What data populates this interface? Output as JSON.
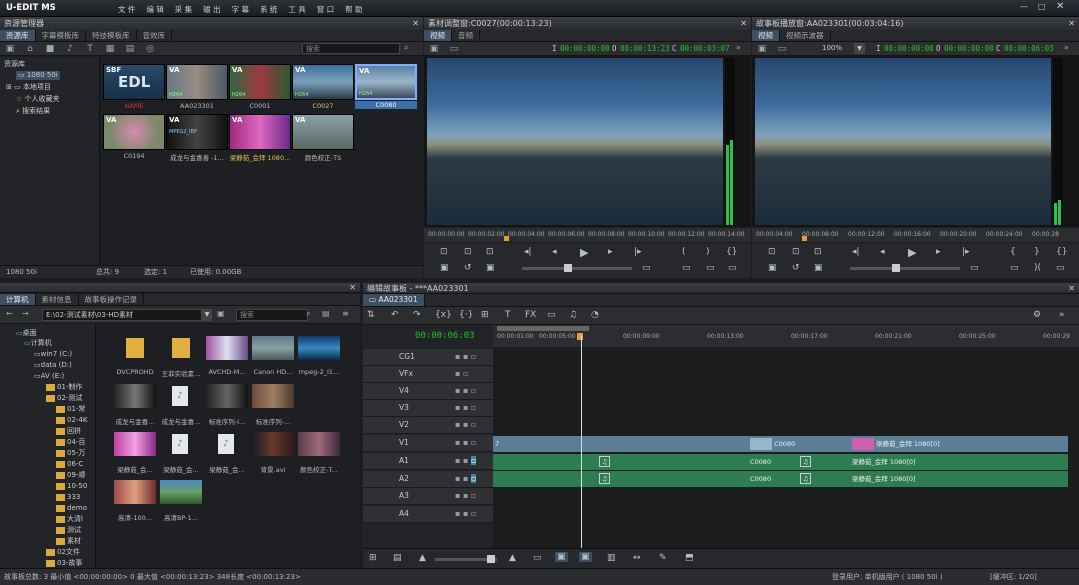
{
  "app": {
    "title": "U-EDIT MS",
    "menu": [
      "文 件",
      "编 辑",
      "采 集",
      "输 出",
      "字 幕",
      "系 统",
      "工 具",
      "窗 口",
      "帮 助"
    ]
  },
  "resource": {
    "title": "资源管理器",
    "tabs": [
      "资源库",
      "字幕模板库",
      "特技模板库",
      "音效库"
    ],
    "search": "搜索",
    "tree_root": "资源库",
    "tree": [
      "1080 50i",
      "本地项目",
      "个人收藏夹",
      "搜索结果"
    ],
    "thumbs": [
      {
        "label": "",
        "badge": "SBF",
        "text": "EDL",
        "color": "#1e3650"
      },
      {
        "label": "AA023301",
        "badge": "VA",
        "color": "#5a6a70"
      },
      {
        "label": "C0001",
        "badge": "VA",
        "color": "#8a3a40"
      },
      {
        "label": "C0027",
        "badge": "VA",
        "color": "#3a6a8a"
      },
      {
        "label": "C0080",
        "badge": "VA",
        "color": "#6a8aa6"
      },
      {
        "label": "C0194",
        "badge": "VA",
        "color": "#8a6070"
      },
      {
        "label": "成龙与金喜善 -1...",
        "badge": "VA",
        "color": "#222"
      },
      {
        "label": "梁静茹_会拜 1080...",
        "badge": "VA",
        "color": "#b04090"
      },
      {
        "label": "颜色校正-TS",
        "badge": "VA",
        "color": "#6a7a7a"
      }
    ],
    "tags": {
      "t0": "NAME",
      "t1": "H264",
      "t2": "H264",
      "t3": "H264",
      "t4": "H264",
      "t6": "MPEG2_IBP"
    },
    "status": [
      "1080 50i",
      "总共: 9",
      "选定: 1",
      "已使用: 0.00GB"
    ]
  },
  "src": {
    "title": "素材调整窗:C0027(00:00:13:23)",
    "tabs": [
      "视频",
      "音频"
    ],
    "tc1": "00:00:00:00",
    "tc2": "00:00:13:23",
    "tc3": "00:00:03:07",
    "ruler": [
      "00:00:00:00",
      "00:00:02:00",
      "00:00:04:00",
      "00:00:06:00",
      "00:00:08:00",
      "00:00:10:00",
      "00:00:12:00",
      "00:00:14:00"
    ]
  },
  "rec": {
    "title": "故事板播放窗:AA023301(00:03:04:16)",
    "tabs": [
      "视频",
      "视频示波器"
    ],
    "zoom": "100%",
    "tc1": "00:00:00:00",
    "tc2": "00:00:00:00",
    "tc3": "00:00:06:03",
    "ruler": [
      "00:00:04:00",
      "00:00:08:00",
      "00:00:12:00",
      "00:00:16:00",
      "00:00:20:00",
      "00:00:24:00",
      "00:00:28"
    ]
  },
  "browser": {
    "tabs": [
      "计算机",
      "素材信息",
      "故事板操作记录"
    ],
    "path": "E:\\02-测试素材\\03-HD素材",
    "search": "搜索",
    "tree": [
      "桌面",
      "计算机",
      "win7 (C:)",
      "data (D:)",
      "AV (E:)",
      "01-制作",
      "02-测试",
      "01-常",
      "02-4K",
      "回拼",
      "04-百",
      "05-万",
      "06-C",
      "09-顺",
      "10-50",
      "333",
      "demo",
      "大清l",
      "测试",
      "素材",
      "02文件",
      "03-故事"
    ],
    "files": [
      "DVCPROHD",
      "王菲实验素...",
      "AVCHD-M...",
      "Canon HD...",
      "mpeg-2_I1...",
      "成龙与金喜...",
      "成龙与金喜...",
      "标准序列-I...",
      "标准序列-...",
      "梁静茹_会...",
      "梁静茹_会...",
      "梁静茹_会...",
      "背景.avi",
      "颜色校正-T...",
      "高清-100...",
      "高清BP-1..."
    ]
  },
  "timeline": {
    "title": "编辑故事板 - ***AA023301",
    "tab": "AA023301",
    "tc": "00:00:06:03",
    "ruler": [
      "00:00:01:00",
      "00:00:05:00",
      "00:00:09:00",
      "00:00:13:00",
      "00:00:17:00",
      "00:00:21:00",
      "00:00:25:00",
      "00:00:29"
    ],
    "tracks": [
      "CG1",
      "VFx",
      "V4",
      "V3",
      "V2",
      "V1",
      "A1",
      "A2",
      "A3",
      "A4"
    ],
    "labelV": "V",
    "labelA1": "A1",
    "labelA2": "A2",
    "clips": {
      "v1a": "7",
      "v1b": "C0080",
      "v1c": "梁静茹_会拜 1080[0]",
      "a1b": "C0080",
      "a1c": "梁静茹_会拜 1080[0]",
      "a2b": "C0080",
      "a2c": "梁静茹_会拜 1080[0]"
    }
  },
  "statusbar": {
    "left": "故事板总数: 3  最小值 <00:00:00:00>  0  最大值 <00:00:13:23>  348长度  <00:00:13:23>",
    "user": "登录用户: 单机版用户 ( 1080 50i )",
    "page": "[缓冲区: 1/20]"
  }
}
